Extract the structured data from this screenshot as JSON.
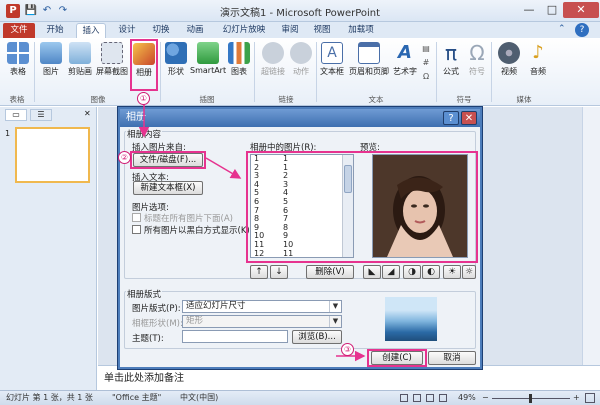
{
  "window": {
    "title": "演示文稿1 - Microsoft PowerPoint",
    "controls": {
      "minimize": "—",
      "maximize": "□",
      "close": "✕"
    }
  },
  "quick_access": [
    "💾",
    "↶",
    "↷"
  ],
  "tabs": [
    "文件",
    "开始",
    "插入",
    "设计",
    "切换",
    "动画",
    "幻灯片放映",
    "审阅",
    "视图",
    "加载项"
  ],
  "active_tab": "插入",
  "ribbon": {
    "buttons": [
      {
        "label": "表格",
        "icon": "table-icon",
        "color": "#5b8fd1"
      },
      {
        "label": "图片",
        "icon": "picture-icon",
        "color": "#6aa3d8"
      },
      {
        "label": "剪贴画",
        "icon": "clipart-icon",
        "color": "#7fb0da"
      },
      {
        "label": "屏幕截图",
        "icon": "screenshot-icon",
        "color": "#8ea7c4"
      },
      {
        "label": "相册",
        "icon": "album-icon",
        "color": "#e07b39"
      },
      {
        "label": "形状",
        "icon": "shapes-icon",
        "color": "#3b7ac0"
      },
      {
        "label": "SmartArt",
        "icon": "smartart-icon",
        "color": "#3ca24a"
      },
      {
        "label": "图表",
        "icon": "chart-icon",
        "color": "#3478c6"
      },
      {
        "label": "超链接",
        "icon": "hyperlink-icon",
        "color": "#9aa7b7"
      },
      {
        "label": "动作",
        "icon": "action-icon",
        "color": "#9aa7b7"
      },
      {
        "label": "文本框",
        "icon": "textbox-icon",
        "color": "#4a6fa8"
      },
      {
        "label": "页眉和页脚",
        "icon": "header-footer-icon",
        "color": "#4a6fa8"
      },
      {
        "label": "艺术字",
        "icon": "wordart-icon",
        "color": "#2a67b1"
      },
      {
        "label": "公式",
        "icon": "equation-icon",
        "color": "#264e86"
      },
      {
        "label": "符号",
        "icon": "symbol-icon",
        "color": "#9aa7b7"
      },
      {
        "label": "视频",
        "icon": "video-icon",
        "color": "#4f5e70"
      },
      {
        "label": "音频",
        "icon": "audio-icon",
        "color": "#d9a020"
      }
    ],
    "groups": [
      "表格",
      "图像",
      "插图",
      "链接",
      "文本",
      "符号",
      "媒体"
    ]
  },
  "left_pane": {
    "tab_slides": "▭",
    "tab_outline": "☰",
    "close": "✕",
    "slide_number": "1"
  },
  "dialog": {
    "title": "相册",
    "help": "?",
    "close": "✕",
    "section_content": "相册内容",
    "insert_from_label": "插入图片来自:",
    "file_disk_button": "文件/磁盘(F)...",
    "insert_text_label": "插入文本:",
    "new_textbox_button": "新建文本框(X)",
    "picture_options_label": "图片选项:",
    "option_caption": "标题在所有图片下面(A)",
    "option_bw": "所有图片以黑白方式显示(K)",
    "pictures_in_album_label": "相册中的图片(R):",
    "list_numbers": [
      "1",
      "2",
      "3",
      "4",
      "5",
      "6",
      "7",
      "8",
      "9",
      "10",
      "11",
      "12"
    ],
    "list_items": [
      "1",
      "1",
      "2",
      "3",
      "4",
      "5",
      "6",
      "7",
      "8",
      "9",
      "10",
      "11"
    ],
    "preview_label": "预览:",
    "remove_button": "删除(V)",
    "section_layout": "相册版式",
    "picture_layout_label": "图片版式(P):",
    "picture_layout_value": "适应幻灯片尺寸",
    "frame_shape_label": "相框形状(M):",
    "frame_shape_value": "矩形",
    "theme_label": "主题(T):",
    "theme_value": "",
    "browse_button": "浏览(B)...",
    "create_button": "创建(C)",
    "cancel_button": "取消"
  },
  "annotations": {
    "step1": "①",
    "step2": "②",
    "step3": "③"
  },
  "notes_placeholder": "单击此处添加备注",
  "status": {
    "slide_info": "幻灯片 第 1 张，共 1 张",
    "theme": "\"Office 主题\"",
    "language": "中文(中国)",
    "zoom": "49%",
    "zoom_level": 0.49
  },
  "colors": {
    "accent_pink": "#e6338f",
    "file_tab": "#c0392b",
    "dialog_title": "#3e6fb0"
  }
}
